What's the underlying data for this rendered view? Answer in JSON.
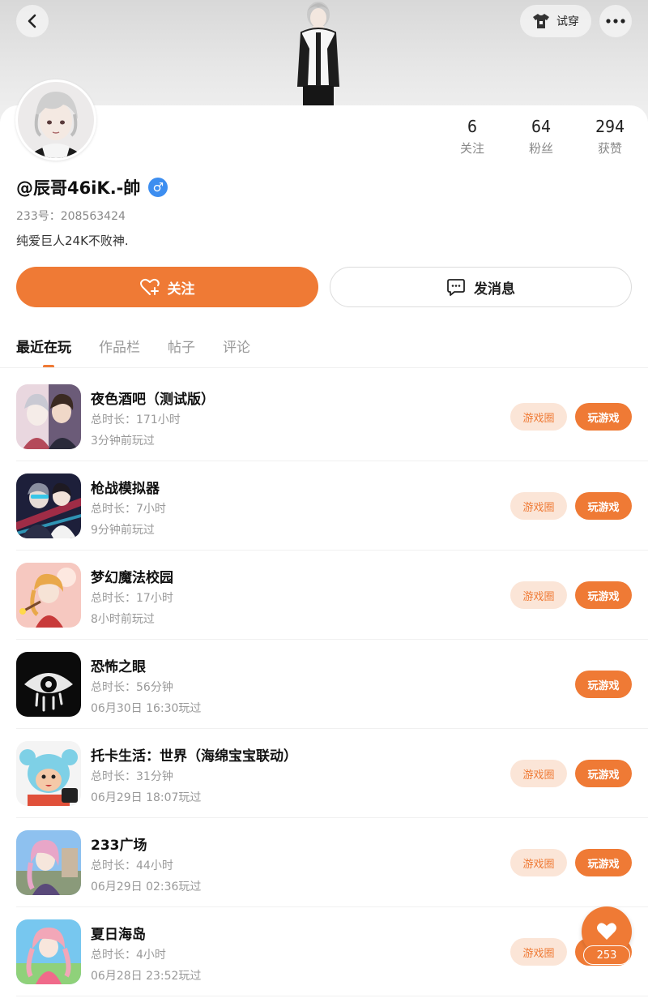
{
  "header": {
    "outfit_label": "试穿"
  },
  "profile": {
    "name": "@辰哥46iK.-帥",
    "gender_symbol": "♂",
    "uid_text": "233号：208563424",
    "bio": "纯爱巨人24K不败神.",
    "stats": [
      {
        "value": "6",
        "label": "关注"
      },
      {
        "value": "64",
        "label": "粉丝"
      },
      {
        "value": "294",
        "label": "获赞"
      }
    ]
  },
  "actions": {
    "follow_label": "关注",
    "message_label": "发消息"
  },
  "tabs": [
    {
      "label": "最近在玩",
      "active": true
    },
    {
      "label": "作品栏",
      "active": false
    },
    {
      "label": "帖子",
      "active": false
    },
    {
      "label": "评论",
      "active": false
    }
  ],
  "games": [
    {
      "title": "夜色酒吧（测试版）",
      "duration": "总时长：171小时",
      "last_played": "3分钟前玩过",
      "circle_label": "游戏圈",
      "play_label": "玩游戏",
      "has_circle": true,
      "icon_colors": [
        "#6b5b78",
        "#e9d7df"
      ]
    },
    {
      "title": "枪战模拟器",
      "duration": "总时长：7小时",
      "last_played": "9分钟前玩过",
      "circle_label": "游戏圈",
      "play_label": "玩游戏",
      "has_circle": true,
      "icon_colors": [
        "#1d1f3a",
        "#c0304a"
      ]
    },
    {
      "title": "梦幻魔法校园",
      "duration": "总时长：17小时",
      "last_played": "8小时前玩过",
      "circle_label": "游戏圈",
      "play_label": "玩游戏",
      "has_circle": true,
      "icon_colors": [
        "#f6c8c0",
        "#e9a84a"
      ]
    },
    {
      "title": "恐怖之眼",
      "duration": "总时长：56分钟",
      "last_played": "06月30日 16:30玩过",
      "circle_label": "",
      "play_label": "玩游戏",
      "has_circle": false,
      "icon_colors": [
        "#0b0b0b",
        "#e8e8e8"
      ]
    },
    {
      "title": "托卡生活：世界（海绵宝宝联动）",
      "duration": "总时长：31分钟",
      "last_played": "06月29日 18:07玩过",
      "circle_label": "游戏圈",
      "play_label": "玩游戏",
      "has_circle": true,
      "icon_colors": [
        "#7ed0e6",
        "#e0503a"
      ]
    },
    {
      "title": "233广场",
      "duration": "总时长：44小时",
      "last_played": "06月29日 02:36玩过",
      "circle_label": "游戏圈",
      "play_label": "玩游戏",
      "has_circle": true,
      "icon_colors": [
        "#8ec1ef",
        "#e8a6c8"
      ]
    },
    {
      "title": "夏日海岛",
      "duration": "总时长：4小时",
      "last_played": "06月28日 23:52玩过",
      "circle_label": "游戏圈",
      "play_label": "",
      "has_circle": true,
      "icon_colors": [
        "#77c7ef",
        "#f2a7b8"
      ]
    }
  ],
  "like": {
    "count": "253"
  },
  "colors": {
    "accent": "#ef7a35",
    "accent_light": "#fbe5d7",
    "gender_badge": "#3d8ef0"
  }
}
